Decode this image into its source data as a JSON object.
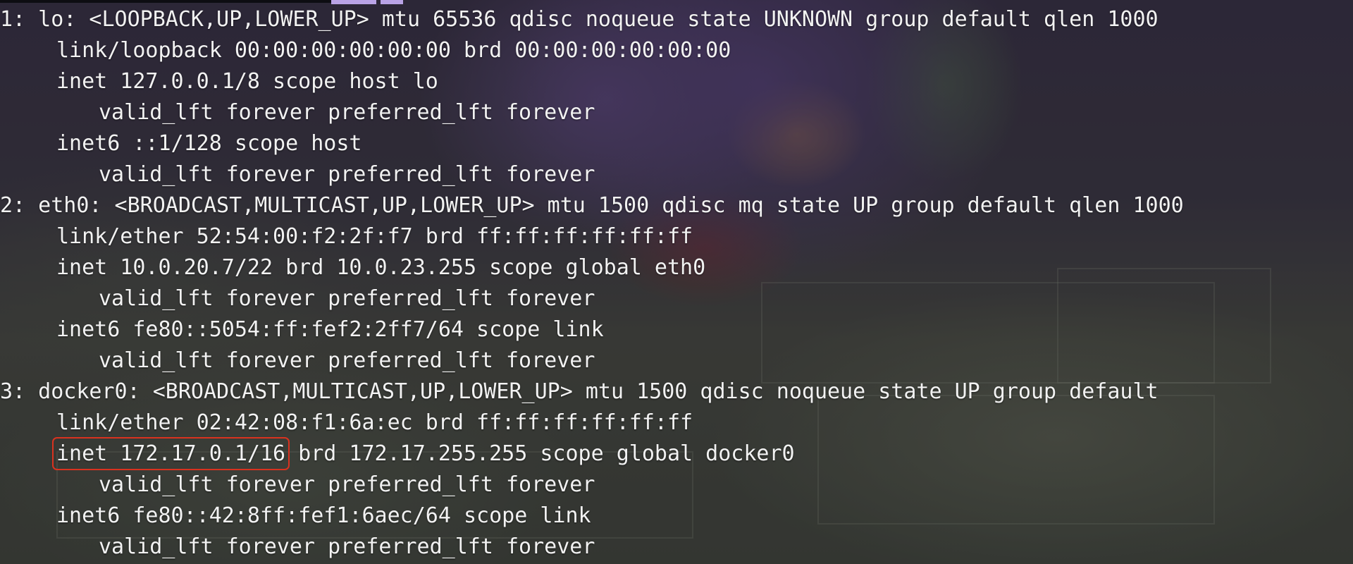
{
  "terminal": {
    "lines": [
      {
        "indent": 0,
        "text": "1: lo: <LOOPBACK,UP,LOWER_UP> mtu 65536 qdisc noqueue state UNKNOWN group default qlen 1000"
      },
      {
        "indent": 1,
        "text": "link/loopback 00:00:00:00:00:00 brd 00:00:00:00:00:00"
      },
      {
        "indent": 1,
        "text": "inet 127.0.0.1/8 scope host lo"
      },
      {
        "indent": 2,
        "text": "valid_lft forever preferred_lft forever"
      },
      {
        "indent": 1,
        "text": "inet6 ::1/128 scope host"
      },
      {
        "indent": 2,
        "text": "valid_lft forever preferred_lft forever"
      },
      {
        "indent": 0,
        "text": "2: eth0: <BROADCAST,MULTICAST,UP,LOWER_UP> mtu 1500 qdisc mq state UP group default qlen 1000"
      },
      {
        "indent": 1,
        "text": "link/ether 52:54:00:f2:2f:f7 brd ff:ff:ff:ff:ff:ff"
      },
      {
        "indent": 1,
        "text": "inet 10.0.20.7/22 brd 10.0.23.255 scope global eth0"
      },
      {
        "indent": 2,
        "text": "valid_lft forever preferred_lft forever"
      },
      {
        "indent": 1,
        "text": "inet6 fe80::5054:ff:fef2:2ff7/64 scope link"
      },
      {
        "indent": 2,
        "text": "valid_lft forever preferred_lft forever"
      },
      {
        "indent": 0,
        "text": "3: docker0: <BROADCAST,MULTICAST,UP,LOWER_UP> mtu 1500 qdisc noqueue state UP group default"
      },
      {
        "indent": 1,
        "text": "link/ether 02:42:08:f1:6a:ec brd ff:ff:ff:ff:ff:ff"
      },
      {
        "indent": 1,
        "text": "inet 172.17.0.1/16",
        "highlight": true,
        "rest": " brd 172.17.255.255 scope global docker0"
      },
      {
        "indent": 2,
        "text": "valid_lft forever preferred_lft forever"
      },
      {
        "indent": 1,
        "text": "inet6 fe80::42:8ff:fef1:6aec/64 scope link"
      },
      {
        "indent": 2,
        "text": "valid_lft forever preferred_lft forever"
      }
    ]
  },
  "colors": {
    "text": "#f2f2f2",
    "highlight_box": "#d9321f",
    "tab_fragment": "#b9a3e6"
  }
}
